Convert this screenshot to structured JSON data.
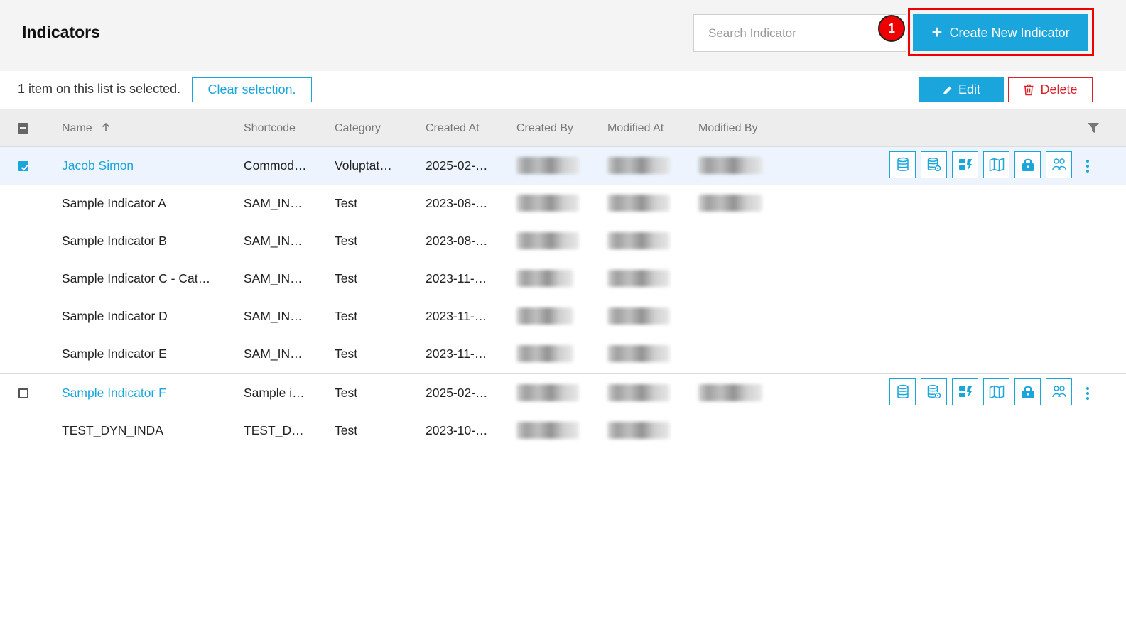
{
  "page_title": "Indicators",
  "search": {
    "placeholder": "Search Indicator"
  },
  "step_badge": "1",
  "create_button": {
    "label": "Create New Indicator"
  },
  "selection": {
    "text": "1 item on this list is selected.",
    "clear_label": "Clear selection."
  },
  "toolbar": {
    "edit_label": "Edit",
    "delete_label": "Delete"
  },
  "columns": [
    "Name",
    "Shortcode",
    "Category",
    "Created At",
    "Created By",
    "Modified At",
    "Modified By"
  ],
  "sort": {
    "column": "Name",
    "direction": "ascending",
    "icon": "arrow-up-icon"
  },
  "rows": [
    {
      "name": "Jacob Simon",
      "shortcode": "Commod…",
      "category": "Voluptat…",
      "created_at": "2025-02-…"
    },
    {
      "name": "Sample Indicator A",
      "shortcode": "SAM_IN…",
      "category": "Test",
      "created_at": "2023-08-…"
    },
    {
      "name": "Sample Indicator B",
      "shortcode": "SAM_IN…",
      "category": "Test",
      "created_at": "2023-08-…"
    },
    {
      "name": "Sample Indicator C - Cat…",
      "shortcode": "SAM_IN…",
      "category": "Test",
      "created_at": "2023-11-…"
    },
    {
      "name": "Sample Indicator D",
      "shortcode": "SAM_IN…",
      "category": "Test",
      "created_at": "2023-11-…"
    },
    {
      "name": "Sample Indicator E",
      "shortcode": "SAM_IN…",
      "category": "Test",
      "created_at": "2023-11-…"
    },
    {
      "name": "Sample Indicator F",
      "shortcode": "Sample i…",
      "category": "Test",
      "created_at": "2025-02-…"
    },
    {
      "name": "TEST_DYN_INDA",
      "shortcode": "TEST_D…",
      "category": "Test",
      "created_at": "2023-10-…"
    }
  ],
  "row_actions_icons": [
    "database-icon",
    "database-settings-icon",
    "dashboard-icon",
    "map-icon",
    "lock-icon",
    "users-icon"
  ],
  "colors": {
    "accent": "#1aa6dd",
    "danger": "#d8232a",
    "highlight": "#ee0000",
    "selected_row_bg": "#edf4fd"
  }
}
